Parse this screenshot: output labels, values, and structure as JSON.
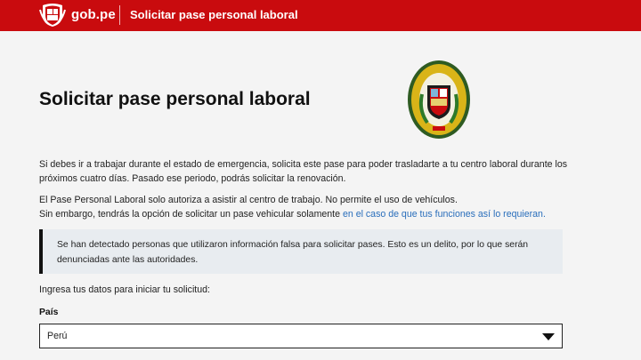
{
  "header": {
    "brand": "gob.pe",
    "title": "Solicitar pase personal laboral",
    "logo_icon": "peru-coat-of-arms-icon",
    "bg_color": "#c90b0e"
  },
  "main": {
    "title": "Solicitar pase personal laboral",
    "seal_icon": "policia-nacional-peru-seal-icon",
    "paragraph1_line1": "Si debes ir a trabajar durante el estado de emergencia, solicita este pase para poder trasladarte a tu centro laboral durante los",
    "paragraph1_line2": "próximos cuatro días. Pasado ese periodo, podrás solicitar la renovación.",
    "paragraph2_line1": "El Pase Personal Laboral solo autoriza a asistir al centro de trabajo. No permite el uso de vehículos.",
    "paragraph2_line2": "Sin embargo, tendrás la opción de solicitar un pase vehicular solamente ",
    "paragraph2_link": "en el caso de que tus funciones así lo requieran.",
    "alert_line1": "Se han detectado personas que utilizaron información falsa para solicitar pases. Esto es un delito, por lo que serán",
    "alert_line2": "denunciadas ante las autoridades.",
    "form_intro": "Ingresa tus datos para iniciar tu solicitud:",
    "country_label": "País",
    "country_value": "Perú",
    "link_color": "#2a6ebb"
  }
}
